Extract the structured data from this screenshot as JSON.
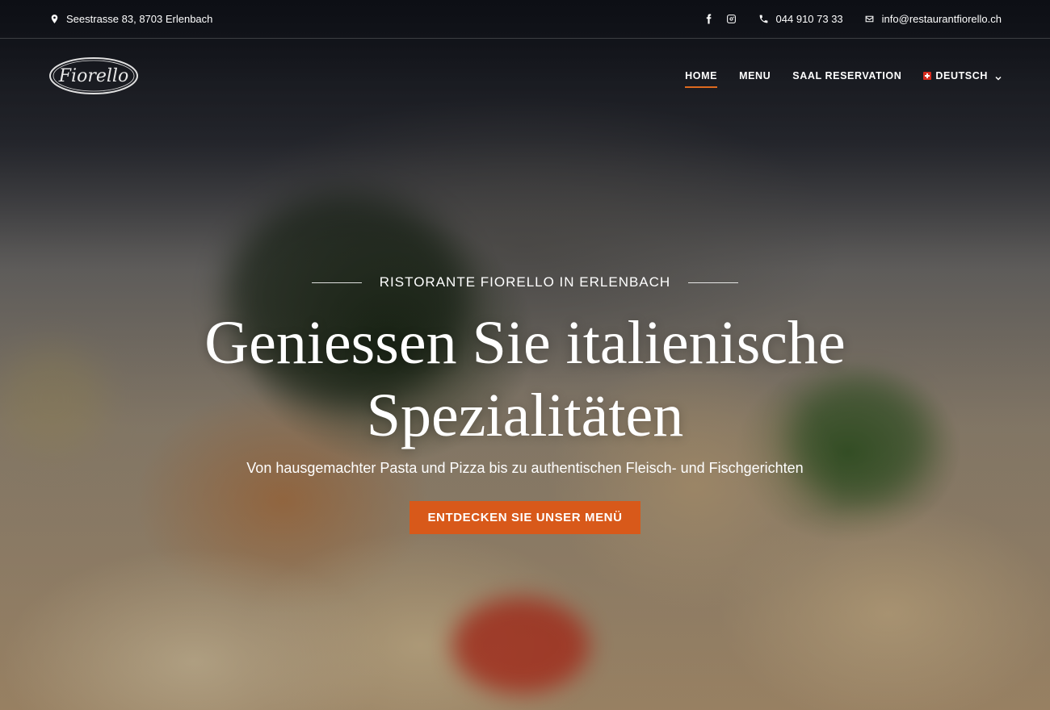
{
  "topbar": {
    "address": "Seestrasse 83, 8703 Erlenbach",
    "social": [
      {
        "icon": "facebook-icon"
      },
      {
        "icon": "instagram-icon"
      }
    ],
    "phone": "044 910 73 33",
    "email": "info@restaurantfiorello.ch"
  },
  "header": {
    "logo_text": "Fiorello",
    "nav": {
      "home": "HOME",
      "menu": "MENU",
      "saal": "SAAL RESERVATION",
      "language": "DEUTSCH"
    }
  },
  "hero": {
    "eyebrow": "RISTORANTE FIORELLO IN ERLENBACH",
    "headline_line1": "Geniessen Sie italienische",
    "headline_line2": "Spezialitäten",
    "subline": "Von hausgemachter Pasta und Pizza bis zu authentischen Fleisch- und Fischgerichten",
    "cta": "ENTDECKEN SIE UNSER MENÜ"
  },
  "colors": {
    "accent": "#d8591a",
    "nav_underline": "#dd6a1f"
  }
}
